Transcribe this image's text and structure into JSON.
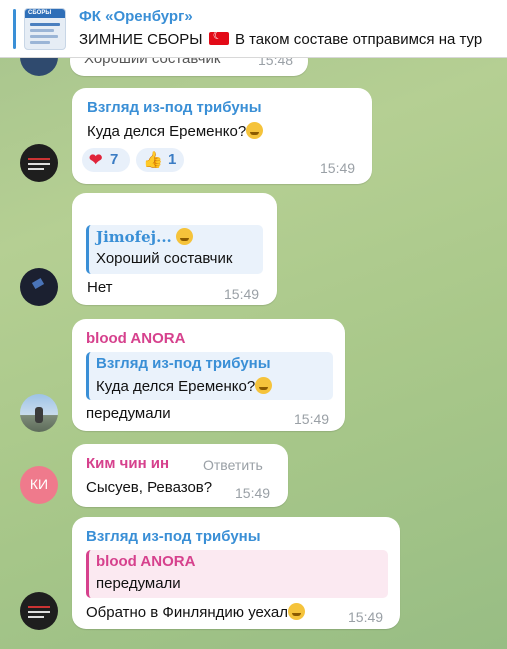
{
  "pinned": {
    "title": "ФК «Оренбург»",
    "text_before_flag": "ЗИМНИЕ СБОРЫ",
    "text_after_flag": "В таком составе отправимся на тур",
    "thumb_label": "СБОРЫ"
  },
  "partial_message": {
    "text": "Хороший составчик",
    "time": "15:48"
  },
  "messages": [
    {
      "sender": "Взгляд из-под трибуны",
      "sender_color": "#3a8fd6",
      "text": "Куда делся Еременко?",
      "time": "15:49",
      "reactions": [
        {
          "icon": "heart-icon",
          "glyph": "❤",
          "count": "7"
        },
        {
          "icon": "thumbs-up-icon",
          "glyph": "👍",
          "count": "1"
        }
      ]
    },
    {
      "reply_name": "Jimofej...",
      "reply_text": "Хороший составчик",
      "text": "Нет",
      "time": "15:49"
    },
    {
      "sender": "blood ANORA",
      "sender_color": "#d6418d",
      "reply_name": "Взгляд из-под трибуны",
      "reply_text": "Куда делся Еременко?",
      "text": "передумали",
      "time": "15:49"
    },
    {
      "sender": "Ким чин ин",
      "sender_color": "#d6418d",
      "reply_action": "Ответить",
      "text": "Сысуев, Ревазов?",
      "time": "15:49",
      "avatar_initials": "КИ"
    },
    {
      "sender": "Взгляд из-под трибуны",
      "sender_color": "#3a8fd6",
      "reply_name": "blood ANORA",
      "reply_text": "передумали",
      "text": "Обратно в Финляндию уехал",
      "time": "15:49"
    }
  ],
  "colors": {
    "accent_blue": "#3a8fd6",
    "accent_pink": "#d6418d",
    "avatar_pink": "#ef7a8c"
  }
}
